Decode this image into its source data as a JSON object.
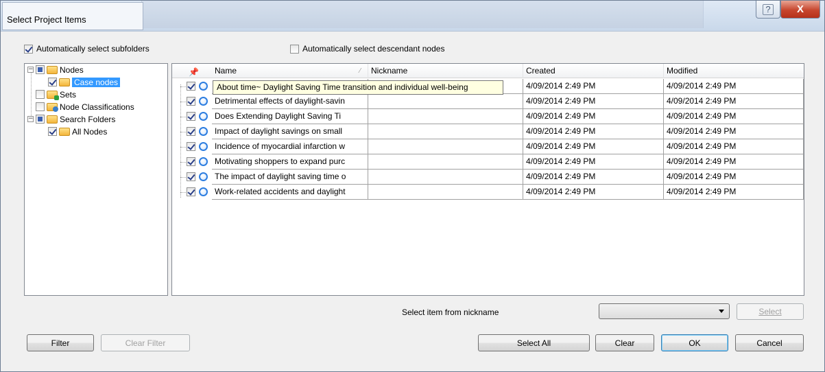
{
  "window": {
    "title": "Select Project Items",
    "help_label": "?",
    "close_label": "X"
  },
  "options": {
    "auto_subfolders": {
      "label": "Automatically select subfolders",
      "checked": true
    },
    "auto_descendants": {
      "label": "Automatically select descendant nodes",
      "checked": false
    }
  },
  "tree": {
    "items": [
      {
        "label": "Nodes",
        "state": "partial",
        "expander": "−",
        "icon": "folder-icon",
        "selected": false
      },
      {
        "label": "Case nodes",
        "state": "checked",
        "expander": "",
        "icon": "case-folder-icon",
        "selected": true
      },
      {
        "label": "Sets",
        "state": "unchecked",
        "expander": "",
        "icon": "sets-folder-icon",
        "selected": false
      },
      {
        "label": "Node Classifications",
        "state": "unchecked",
        "expander": "",
        "icon": "classification-folder-icon",
        "selected": false
      },
      {
        "label": "Search Folders",
        "state": "partial",
        "expander": "−",
        "icon": "folder-icon",
        "selected": false
      },
      {
        "label": "All Nodes",
        "state": "checked",
        "expander": "",
        "icon": "folder-icon",
        "selected": false
      }
    ]
  },
  "grid": {
    "columns": [
      "Name",
      "Nickname",
      "Created",
      "Modified"
    ],
    "sort_glyph": "⁄",
    "rows": [
      {
        "name": "About time~ Daylight Saving",
        "nickname": "",
        "created": "4/09/2014 2:49 PM",
        "modified": "4/09/2014 2:49 PM"
      },
      {
        "name": "Detrimental effects of daylight-savin",
        "nickname": "",
        "created": "4/09/2014 2:49 PM",
        "modified": "4/09/2014 2:49 PM"
      },
      {
        "name": "Does Extending Daylight Saving Ti",
        "nickname": "",
        "created": "4/09/2014 2:49 PM",
        "modified": "4/09/2014 2:49 PM"
      },
      {
        "name": "Impact of daylight savings on small",
        "nickname": "",
        "created": "4/09/2014 2:49 PM",
        "modified": "4/09/2014 2:49 PM"
      },
      {
        "name": "Incidence of myocardial infarction w",
        "nickname": "",
        "created": "4/09/2014 2:49 PM",
        "modified": "4/09/2014 2:49 PM"
      },
      {
        "name": "Motivating shoppers to expand purc",
        "nickname": "",
        "created": "4/09/2014 2:49 PM",
        "modified": "4/09/2014 2:49 PM"
      },
      {
        "name": "The impact of daylight saving time o",
        "nickname": "",
        "created": "4/09/2014 2:49 PM",
        "modified": "4/09/2014 2:49 PM"
      },
      {
        "name": "Work-related accidents and daylight",
        "nickname": "",
        "created": "4/09/2014 2:49 PM",
        "modified": "4/09/2014 2:49 PM"
      }
    ],
    "tooltip": "About time~ Daylight Saving Time transition and individual well-being"
  },
  "nickname_select": {
    "label": "Select item from nickname",
    "value": "",
    "select_label": "Select"
  },
  "buttons": {
    "filter": "Filter",
    "clear_filter": "Clear Filter",
    "select_all": "Select All",
    "clear": "Clear",
    "ok": "OK",
    "cancel": "Cancel"
  }
}
